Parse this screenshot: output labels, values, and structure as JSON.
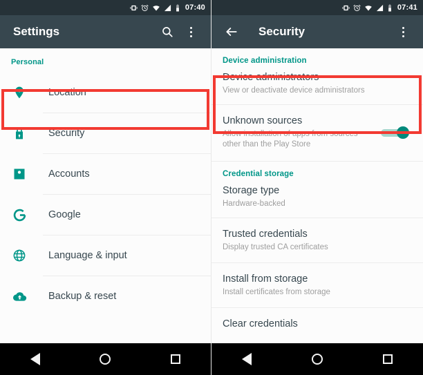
{
  "left": {
    "status": {
      "time": "07:40",
      "icons": [
        "vibrate-icon",
        "alarm-icon",
        "wifi-icon",
        "signal-icon",
        "battery-icon"
      ]
    },
    "actionbar": {
      "title": "Settings",
      "search_icon": "search-icon",
      "overflow_icon": "more-vert-icon"
    },
    "section_label": "Personal",
    "items": [
      {
        "label": "Location",
        "icon": "location-pin-icon"
      },
      {
        "label": "Security",
        "icon": "lock-icon"
      },
      {
        "label": "Accounts",
        "icon": "account-box-icon"
      },
      {
        "label": "Google",
        "icon": "google-g-icon"
      },
      {
        "label": "Language & input",
        "icon": "globe-icon"
      },
      {
        "label": "Backup & reset",
        "icon": "cloud-upload-icon"
      }
    ],
    "highlighted_item": "Security"
  },
  "right": {
    "status": {
      "time": "07:41",
      "icons": [
        "vibrate-icon",
        "alarm-icon",
        "wifi-icon",
        "signal-icon",
        "battery-icon"
      ]
    },
    "actionbar": {
      "title": "Security",
      "back_icon": "arrow-back-icon",
      "overflow_icon": "more-vert-icon"
    },
    "sections": [
      {
        "label": "Device administration",
        "rows": [
          {
            "title": "Device administrators",
            "subtitle": "View or deactivate device administrators",
            "toggle": null
          },
          {
            "title": "Unknown sources",
            "subtitle": "Allow installation of apps from sources other than the Play Store",
            "toggle": "on"
          }
        ]
      },
      {
        "label": "Credential storage",
        "rows": [
          {
            "title": "Storage type",
            "subtitle": "Hardware-backed",
            "toggle": null
          },
          {
            "title": "Trusted credentials",
            "subtitle": "Display trusted CA certificates",
            "toggle": null
          },
          {
            "title": "Install from storage",
            "subtitle": "Install certificates from storage",
            "toggle": null
          },
          {
            "title": "Clear credentials",
            "subtitle": "",
            "toggle": null
          }
        ]
      }
    ],
    "highlighted_row": "Unknown sources"
  },
  "navbar": {
    "back": "back-triangle-icon",
    "home": "home-circle-icon",
    "recents": "recents-square-icon"
  },
  "colors": {
    "accent": "#009688",
    "highlight": "#f23a32",
    "actionbar": "#37474f",
    "statusbar": "#263238"
  }
}
